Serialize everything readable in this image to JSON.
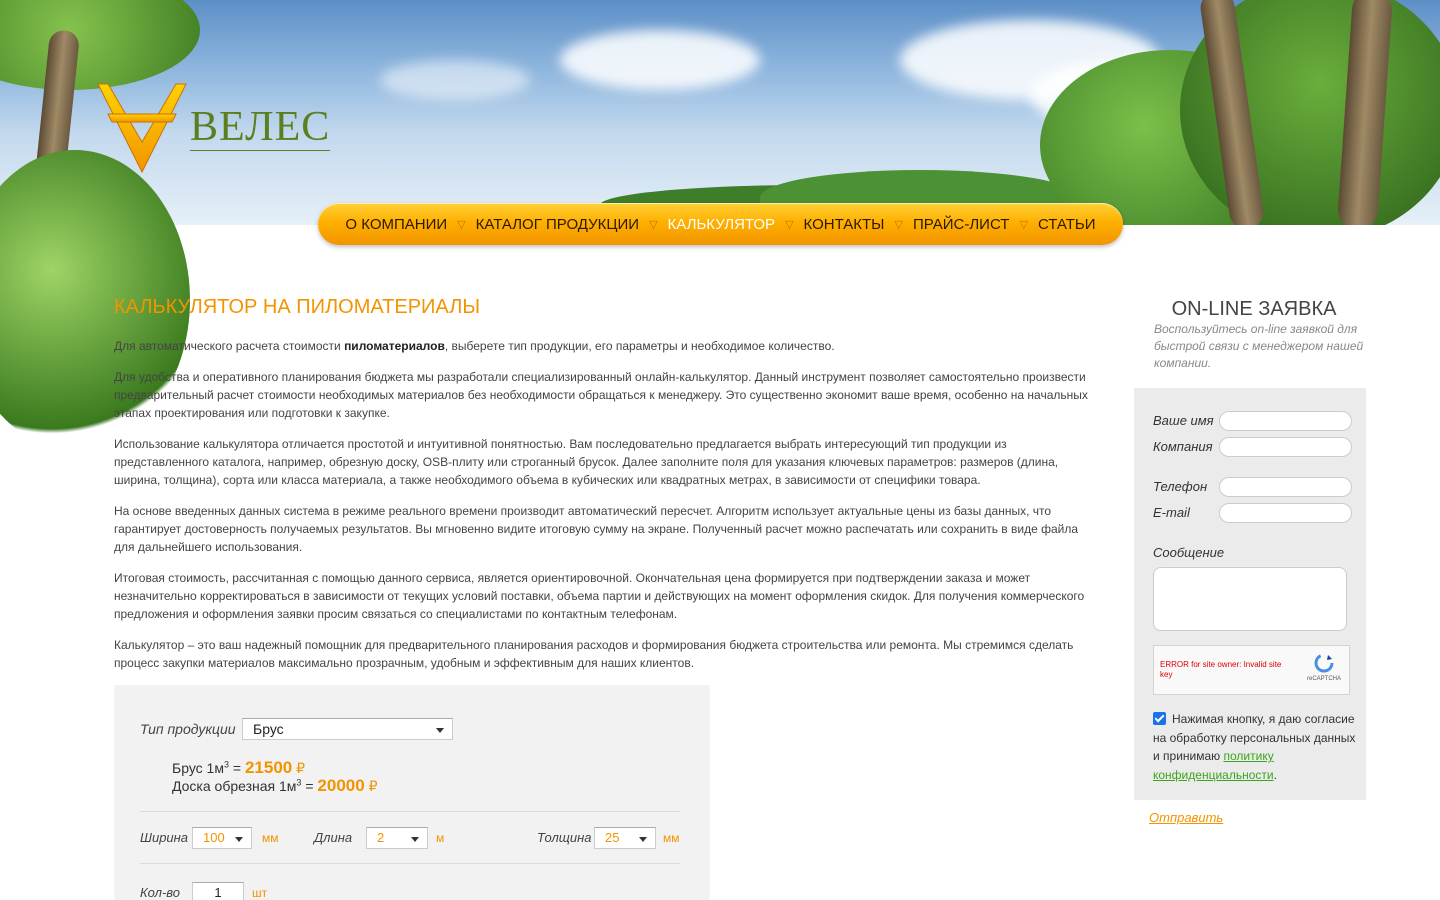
{
  "logo": {
    "text": "ВЕЛЕС",
    "icon": "veles-logo-icon"
  },
  "nav": {
    "items": [
      {
        "label": "О КОМПАНИИ",
        "active": false
      },
      {
        "label": "КАТАЛОГ ПРОДУКЦИИ",
        "active": false
      },
      {
        "label": "КАЛЬКУЛЯТОР",
        "active": true
      },
      {
        "label": "КОНТАКТЫ",
        "active": false
      },
      {
        "label": "ПРАЙС-ЛИСТ",
        "active": false
      },
      {
        "label": "СТАТЬИ",
        "active": false
      }
    ],
    "separator": "▽"
  },
  "main": {
    "title": "КАЛЬКУЛЯТОР НА ПИЛОМАТЕРИАЛЫ",
    "intro_before": "Для автоматического расчета стоимости ",
    "intro_bold": "пиломатериалов",
    "intro_after": ", выберете тип продукции, его параметры и необходимое количество.",
    "paragraphs": [
      "Для удобства и оперативного планирования бюджета мы разработали специализированный онлайн-калькулятор. Данный инструмент позволяет самостоятельно произвести предварительный расчет стоимости необходимых материалов без необходимости обращаться к менеджеру. Это существенно экономит ваше время, особенно на начальных этапах проектирования или подготовки к закупке.",
      "Использование калькулятора отличается простотой и интуитивной понятностью. Вам последовательно предлагается выбрать интересующий тип продукции из представленного каталога, например, обрезную доску, OSB-плиту или строганный брусок. Далее заполните поля для указания ключевых параметров: размеров (длина, ширина, толщина), сорта или класса материала, а также необходимого объема в кубических или квадратных метрах, в зависимости от специфики товара.",
      "На основе введенных данных система в режиме реального времени производит автоматический пересчет. Алгоритм использует актуальные цены из базы данных, что гарантирует достоверность получаемых результатов. Вы мгновенно видите итоговую сумму на экране. Полученный расчет можно распечатать или сохранить в виде файла для дальнейшего использования.",
      "Итоговая стоимость, рассчитанная с помощью данного сервиса, является ориентировочной. Окончательная цена формируется при подтверждении заказа и может незначительно корректироваться в зависимости от текущих условий поставки, объема партии и действующих на момент оформления скидок. Для получения коммерческого предложения и оформления заявки просим связаться со специалистами по контактным телефонам.",
      "Калькулятор – это ваш надежный помощник для предварительного планирования расходов и формирования бюджета строительства или ремонта. Мы стремимся сделать процесс закупки материалов максимально прозрачным, удобным и эффективным для наших клиентов."
    ]
  },
  "calculator": {
    "type_label": "Тип продукции",
    "type_value": "Брус",
    "price1_name": "Брус 1м",
    "price1_value": "21500",
    "price2_name": "Доска обрезная 1м",
    "price2_value": "20000",
    "sup": "3",
    "eq": " = ",
    "currency": "₽",
    "width_label": "Ширина",
    "width_value": "100",
    "width_unit": "мм",
    "length_label": "Длина",
    "length_value": "2",
    "length_unit": "м",
    "thickness_label": "Толщина",
    "thickness_value": "25",
    "thickness_unit": "мм",
    "qty_label": "Кол-во",
    "qty_value": "1",
    "qty_unit": "шт"
  },
  "sidebar": {
    "title": "ON-LINE ЗАЯВКА",
    "subtitle": "Воспользуйтесь on-line заявкой для быстрой связи с менеджером нашей компании.",
    "name_label": "Ваше имя",
    "company_label": "Компания",
    "phone_label": "Телефон",
    "email_label": "E-mail",
    "message_label": "Сообщение",
    "captcha_error": "ERROR for site owner: Invalid site key",
    "captcha_brand": "reCAPTCHA",
    "consent_text": "Нажимая кнопку, я даю согласие на обработку персональных данных и принимаю ",
    "policy_link": "политику конфиденциальности",
    "consent_end": ".",
    "consent_checked": true,
    "send_label": "Отправить"
  },
  "colors": {
    "accent": "#f29400",
    "logo_green": "#5b7f1f",
    "link_green": "#3aa51c"
  }
}
